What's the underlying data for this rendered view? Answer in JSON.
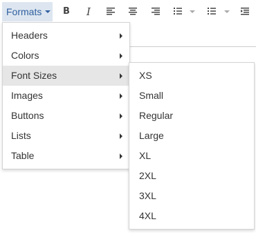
{
  "toolbar": {
    "formats_label": "Formats",
    "icons": [
      "bold-icon",
      "italic-icon",
      "align-left-icon",
      "align-center-icon",
      "align-right-icon",
      "bullet-list-icon",
      "numbered-list-icon",
      "indent-icon"
    ]
  },
  "formats_menu": {
    "items": [
      {
        "label": "Headers"
      },
      {
        "label": "Colors"
      },
      {
        "label": "Font Sizes"
      },
      {
        "label": "Images"
      },
      {
        "label": "Buttons"
      },
      {
        "label": "Lists"
      },
      {
        "label": "Table"
      }
    ],
    "active_item": "Font Sizes"
  },
  "font_sizes_menu": {
    "items": [
      {
        "label": "XS"
      },
      {
        "label": "Small"
      },
      {
        "label": "Regular"
      },
      {
        "label": "Large"
      },
      {
        "label": "XL"
      },
      {
        "label": "2XL"
      },
      {
        "label": "3XL"
      },
      {
        "label": "4XL"
      }
    ]
  },
  "colors": {
    "accent_text": "#2f5fa0",
    "accent_bg": "#dde6f0",
    "active_bg": "#e6e6e6"
  }
}
